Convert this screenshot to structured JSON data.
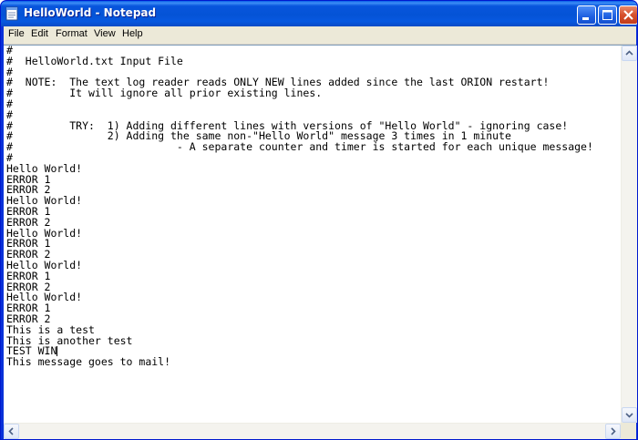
{
  "window": {
    "title": "HelloWorld - Notepad",
    "app_icon": "notepad-icon",
    "controls": [
      "minimize-icon",
      "maximize-icon",
      "close-icon"
    ]
  },
  "menu": {
    "file": "File",
    "edit": "Edit",
    "format": "Format",
    "view": "View",
    "help": "Help"
  },
  "document": {
    "lines": [
      "#",
      "#  HelloWorld.txt Input File",
      "#",
      "#  NOTE:  The text log reader reads ONLY NEW lines added since the last ORION restart!",
      "#         It will ignore all prior existing lines.",
      "#",
      "#",
      "#         TRY:  1) Adding different lines with versions of \"Hello World\" - ignoring case!",
      "#               2) Adding the same non-\"Hello World\" message 3 times in 1 minute",
      "#                          - A separate counter and timer is started for each unique message!",
      "#",
      "Hello World!",
      "ERROR 1",
      "ERROR 2",
      "Hello World!",
      "ERROR 1",
      "ERROR 2",
      "Hello World!",
      "ERROR 1",
      "ERROR 2",
      "Hello World!",
      "ERROR 1",
      "ERROR 2",
      "Hello World!",
      "ERROR 1",
      "ERROR 2",
      "This is a test",
      "This is another test",
      "TEST WIN",
      "This message goes to mail!"
    ],
    "caret_line_index": 28
  },
  "colors": {
    "titlebar": "#0453d6",
    "close_button": "#d6502c",
    "menubar": "#ece9d8"
  }
}
